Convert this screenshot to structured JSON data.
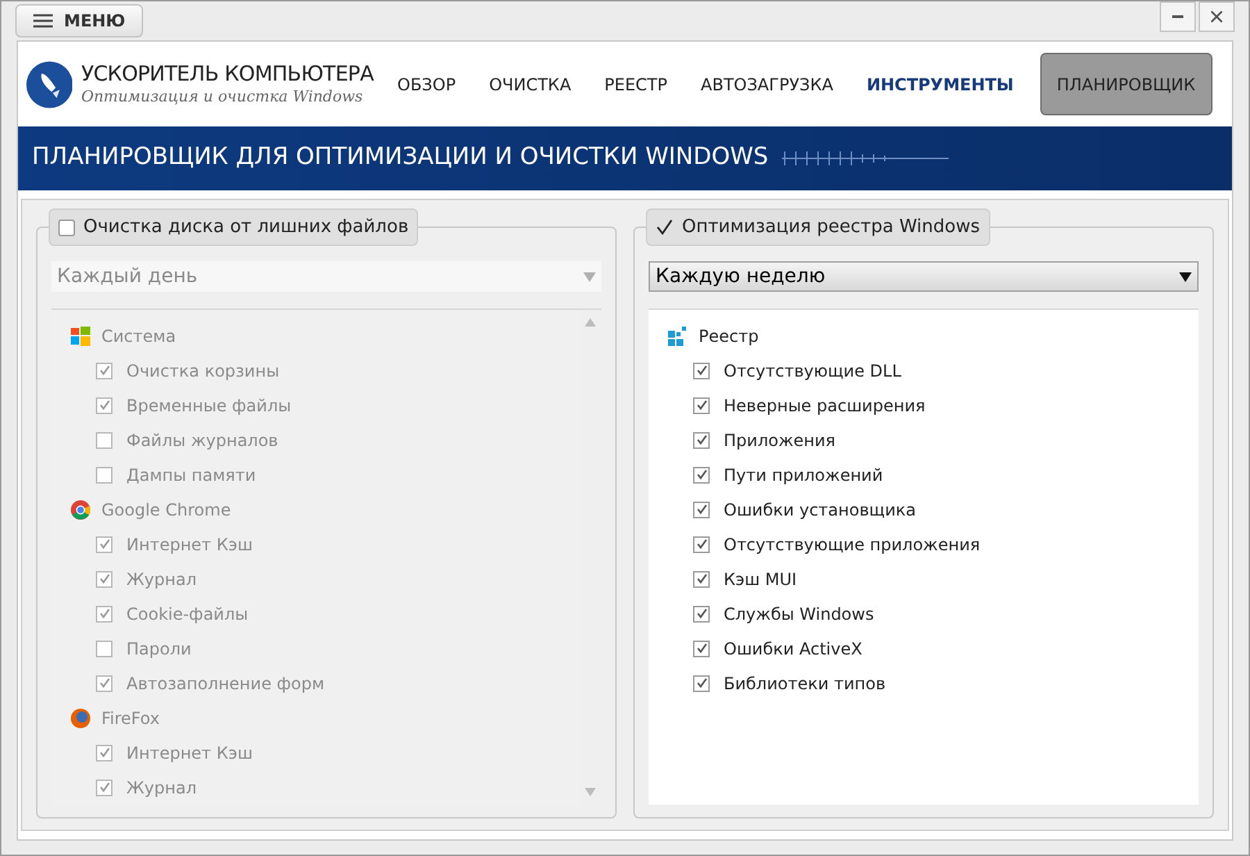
{
  "menu_button": "МЕНЮ",
  "logo": {
    "title": "УСКОРИТЕЛЬ КОМПЬЮТЕРА",
    "subtitle": "Оптимизация и очистка Windows"
  },
  "nav": [
    {
      "label": "ОБЗОР",
      "selected": false,
      "emphasized": false
    },
    {
      "label": "ОЧИСТКА",
      "selected": false,
      "emphasized": false
    },
    {
      "label": "РЕЕСТР",
      "selected": false,
      "emphasized": false
    },
    {
      "label": "АВТОЗАГРУЗКА",
      "selected": false,
      "emphasized": false
    },
    {
      "label": "ИНСТРУМЕНТЫ",
      "selected": false,
      "emphasized": true
    },
    {
      "label": "ПЛАНИРОВЩИК",
      "selected": true,
      "emphasized": false
    }
  ],
  "banner": "ПЛАНИРОВЩИК ДЛЯ ОПТИМИЗАЦИИ И ОЧИСТКИ WINDOWS",
  "panels": [
    {
      "title": "Очистка диска от лишних файлов",
      "checked": false,
      "schedule": "Каждый день",
      "scrollable": true,
      "groups": [
        {
          "label": "Система",
          "kind": "windows",
          "children": [
            {
              "label": "Очистка корзины",
              "checked": true
            },
            {
              "label": "Временные файлы",
              "checked": true
            },
            {
              "label": "Файлы журналов",
              "checked": false
            },
            {
              "label": "Дампы памяти",
              "checked": false
            }
          ]
        },
        {
          "label": "Google Chrome",
          "kind": "chrome",
          "children": [
            {
              "label": "Интернет Кэш",
              "checked": true
            },
            {
              "label": "Журнал",
              "checked": true
            },
            {
              "label": "Cookie-файлы",
              "checked": true
            },
            {
              "label": "Пароли",
              "checked": false
            },
            {
              "label": "Автозаполнение форм",
              "checked": true
            }
          ]
        },
        {
          "label": "FireFox",
          "kind": "firefox",
          "children": [
            {
              "label": "Интернет Кэш",
              "checked": true
            },
            {
              "label": "Журнал",
              "checked": true
            }
          ]
        }
      ]
    },
    {
      "title": "Оптимизация реестра Windows",
      "checked": true,
      "schedule": "Каждую неделю",
      "scrollable": false,
      "groups": [
        {
          "label": "Реестр",
          "kind": "registry",
          "children": [
            {
              "label": "Отсутствующие DLL",
              "checked": true
            },
            {
              "label": "Неверные расширения",
              "checked": true
            },
            {
              "label": "Приложения",
              "checked": true
            },
            {
              "label": "Пути приложений",
              "checked": true
            },
            {
              "label": "Ошибки установщика",
              "checked": true
            },
            {
              "label": "Отсутствующие приложения",
              "checked": true
            },
            {
              "label": "Кэш MUI",
              "checked": true
            },
            {
              "label": "Службы Windows",
              "checked": true
            },
            {
              "label": "Ошибки ActiveX",
              "checked": true
            },
            {
              "label": "Библиотеки типов",
              "checked": true
            }
          ]
        }
      ]
    }
  ]
}
